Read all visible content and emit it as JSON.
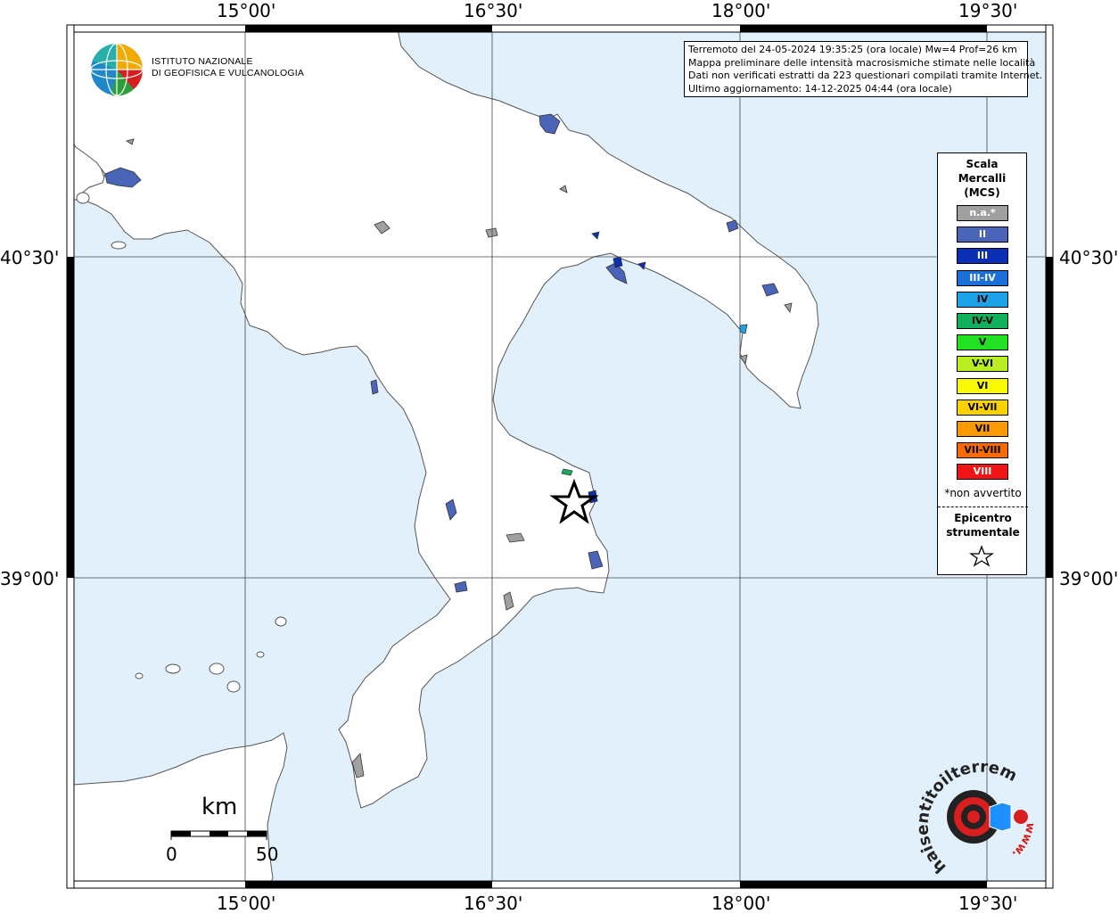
{
  "map": {
    "colors": {
      "sea": "#e1f0fb",
      "land": "#ffffff",
      "frame": "#000000",
      "grid": "#444444"
    },
    "longitude_ticks": [
      "15°00'",
      "16°30'",
      "18°00'",
      "19°30'"
    ],
    "latitude_ticks": [
      "40°30'",
      "39°00'"
    ]
  },
  "logo": {
    "line1": "ISTITUTO NAZIONALE",
    "line2": "DI GEOFISICA E VULCANOLOGIA"
  },
  "info": {
    "line1": "Terremoto del 24-05-2024 19:35:25 (ora locale) Mw=4 Prof=26 km",
    "line2": "Mappa preliminare delle intensità macrosismiche stimate nelle località",
    "line3": "Dati non verificati estratti da 223 questionari compilati tramite Internet.",
    "line4": "Ultimo aggiornamento: 14-12-2025 04:44 (ora locale)"
  },
  "legend": {
    "title_1": "Scala",
    "title_2": "Mercalli",
    "title_3": "(MCS)",
    "items": [
      {
        "label": "n.a.*",
        "color": "#a0a0a0",
        "text_color": "#ffffff"
      },
      {
        "label": "II",
        "color": "#4a64b8",
        "text_color": "#ffffff"
      },
      {
        "label": "III",
        "color": "#0a2fb5",
        "text_color": "#ffffff"
      },
      {
        "label": "III-IV",
        "color": "#1a6fd8",
        "text_color": "#ffffff"
      },
      {
        "label": "IV",
        "color": "#1ea2e6",
        "text_color": "#000000"
      },
      {
        "label": "IV-V",
        "color": "#12b05c",
        "text_color": "#000000"
      },
      {
        "label": "V",
        "color": "#22e022",
        "text_color": "#000000"
      },
      {
        "label": "V-VI",
        "color": "#b8ee22",
        "text_color": "#000000"
      },
      {
        "label": "VI",
        "color": "#fafa00",
        "text_color": "#000000"
      },
      {
        "label": "VI-VII",
        "color": "#fad200",
        "text_color": "#000000"
      },
      {
        "label": "VII",
        "color": "#fa9a00",
        "text_color": "#000000"
      },
      {
        "label": "VII-VIII",
        "color": "#fa6a00",
        "text_color": "#000000"
      },
      {
        "label": "VIII",
        "color": "#f01414",
        "text_color": "#ffffff"
      }
    ],
    "note": "*non avvertito",
    "epicenter_1": "Epicentro",
    "epicenter_2": "strumentale",
    "epicenter_symbol": "star-icon"
  },
  "scalebar": {
    "unit": "km",
    "start": "0",
    "end": "50"
  },
  "watermark": {
    "text": "haisentitoilterremoto.it",
    "url_prefix": "www."
  }
}
